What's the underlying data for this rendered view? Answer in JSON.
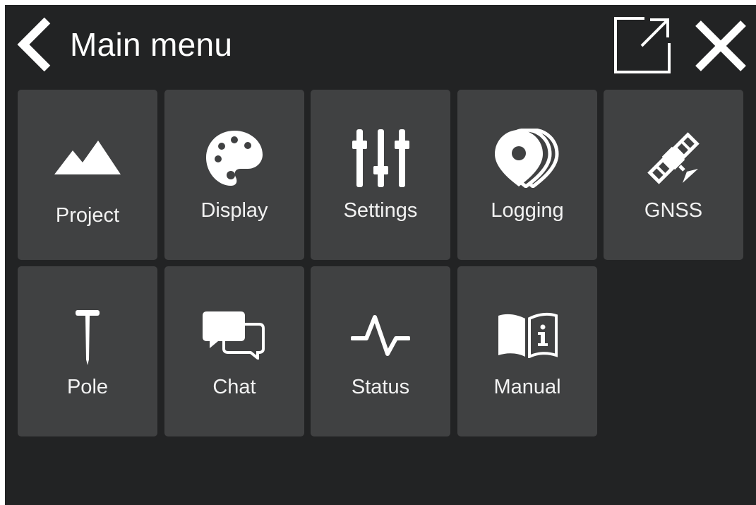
{
  "header": {
    "title": "Main menu",
    "back_icon": "chevron-left-icon",
    "popout_icon": "external-window-icon",
    "close_icon": "close-icon"
  },
  "menu": {
    "items": [
      {
        "label": "Project",
        "icon": "mountains-icon"
      },
      {
        "label": "Display",
        "icon": "palette-icon"
      },
      {
        "label": "Settings",
        "icon": "sliders-icon"
      },
      {
        "label": "Logging",
        "icon": "location-pins-icon"
      },
      {
        "label": "GNSS",
        "icon": "satellite-icon"
      },
      {
        "label": "Pole",
        "icon": "survey-pole-icon"
      },
      {
        "label": "Chat",
        "icon": "chat-bubbles-icon"
      },
      {
        "label": "Status",
        "icon": "pulse-icon"
      },
      {
        "label": "Manual",
        "icon": "manual-book-icon"
      }
    ]
  },
  "colors": {
    "background": "#222324",
    "tile": "#404142",
    "text": "#ffffff"
  }
}
